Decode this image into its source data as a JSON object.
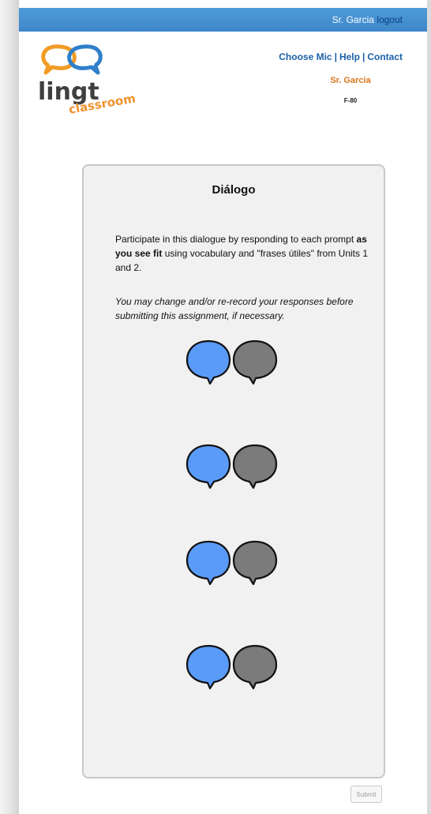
{
  "header": {
    "user_name": "Sr. Garcia",
    "logout_label": "logout"
  },
  "logo": {
    "word": "lingt",
    "tagline": "classroom",
    "icon": "speech-bubbles-logo-icon"
  },
  "nav": {
    "items": [
      {
        "label": "Choose Mic"
      },
      {
        "label": "Help"
      },
      {
        "label": "Contact"
      }
    ],
    "separator": "|"
  },
  "teacher": {
    "name": "Sr. Garcia",
    "class_code": "F-80"
  },
  "assignment": {
    "title": "Diálogo",
    "intro_before": "Participate in this dialogue by responding to each prompt ",
    "intro_bold": "as you see fit",
    "intro_after": " using vocabulary and \"frases útiles\" from Units 1 and 2.",
    "note": "You may change and/or re-record your responses before submitting this assignment, if necessary."
  },
  "dialogue": {
    "pairs": [
      {
        "prompt_icon": "blue-speech-bubble-icon",
        "response_icon": "gray-speech-bubble-icon"
      },
      {
        "prompt_icon": "blue-speech-bubble-icon",
        "response_icon": "gray-speech-bubble-icon"
      },
      {
        "prompt_icon": "blue-speech-bubble-icon",
        "response_icon": "gray-speech-bubble-icon"
      },
      {
        "prompt_icon": "blue-speech-bubble-icon",
        "response_icon": "gray-speech-bubble-icon"
      }
    ]
  },
  "actions": {
    "submit_label": "Submit"
  },
  "colors": {
    "topbar": "#3f87c9",
    "link": "#1b62a8",
    "teacher": "#d9771a",
    "prompt_bubble": "#5a9bf8",
    "response_bubble": "#7b7b7b"
  }
}
